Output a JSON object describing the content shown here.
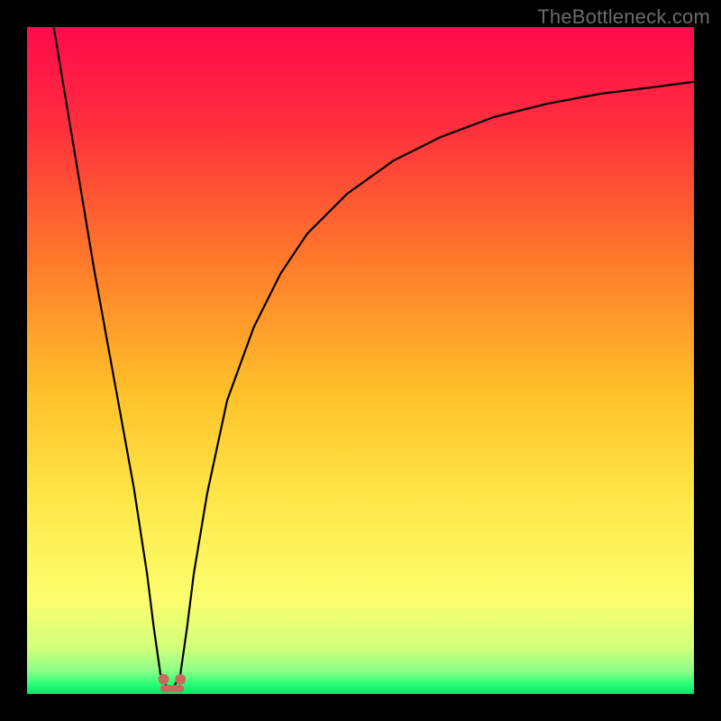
{
  "watermark": {
    "text": "TheBottleneck.com"
  },
  "chart_data": {
    "type": "line",
    "title": "",
    "xlabel": "",
    "ylabel": "",
    "xlim": [
      0,
      100
    ],
    "ylim": [
      0,
      100
    ],
    "legend": false,
    "grid": false,
    "gradient_stops": [
      {
        "pos": 0.0,
        "color": "#ff0a4d"
      },
      {
        "pos": 0.15,
        "color": "#ff2f3d"
      },
      {
        "pos": 0.35,
        "color": "#ff7a2a"
      },
      {
        "pos": 0.55,
        "color": "#ffc22a"
      },
      {
        "pos": 0.72,
        "color": "#ffe94a"
      },
      {
        "pos": 0.86,
        "color": "#fbff6e"
      },
      {
        "pos": 0.93,
        "color": "#d3ff7a"
      },
      {
        "pos": 0.965,
        "color": "#8dff87"
      },
      {
        "pos": 0.985,
        "color": "#2bff7a"
      },
      {
        "pos": 1.0,
        "color": "#00e765"
      }
    ],
    "series": [
      {
        "name": "bottleneck-curve",
        "color": "#000000",
        "stroke_width": 2.2,
        "x": [
          4,
          6,
          8,
          10,
          12,
          14,
          16,
          18,
          19,
          20,
          21,
          22,
          23,
          24,
          25,
          27,
          30,
          34,
          38,
          42,
          48,
          55,
          62,
          70,
          78,
          86,
          94,
          100
        ],
        "y": [
          100,
          88,
          76,
          64,
          53,
          42,
          31,
          18,
          10,
          3,
          1,
          1,
          3,
          10,
          18,
          30,
          44,
          55,
          63,
          69,
          75,
          80,
          83.5,
          86.5,
          88.5,
          90,
          91,
          91.8
        ]
      }
    ],
    "markers": [
      {
        "name": "min-region-left",
        "x": 20.5,
        "y": 2.2,
        "r": 6,
        "color": "#c96a5c"
      },
      {
        "name": "min-region-right",
        "x": 23.0,
        "y": 2.2,
        "r": 6,
        "color": "#c96a5c"
      }
    ],
    "marker_bridge": {
      "x1": 20.5,
      "x2": 23.0,
      "y": 0.8,
      "color": "#c96a5c",
      "width": 8
    }
  }
}
